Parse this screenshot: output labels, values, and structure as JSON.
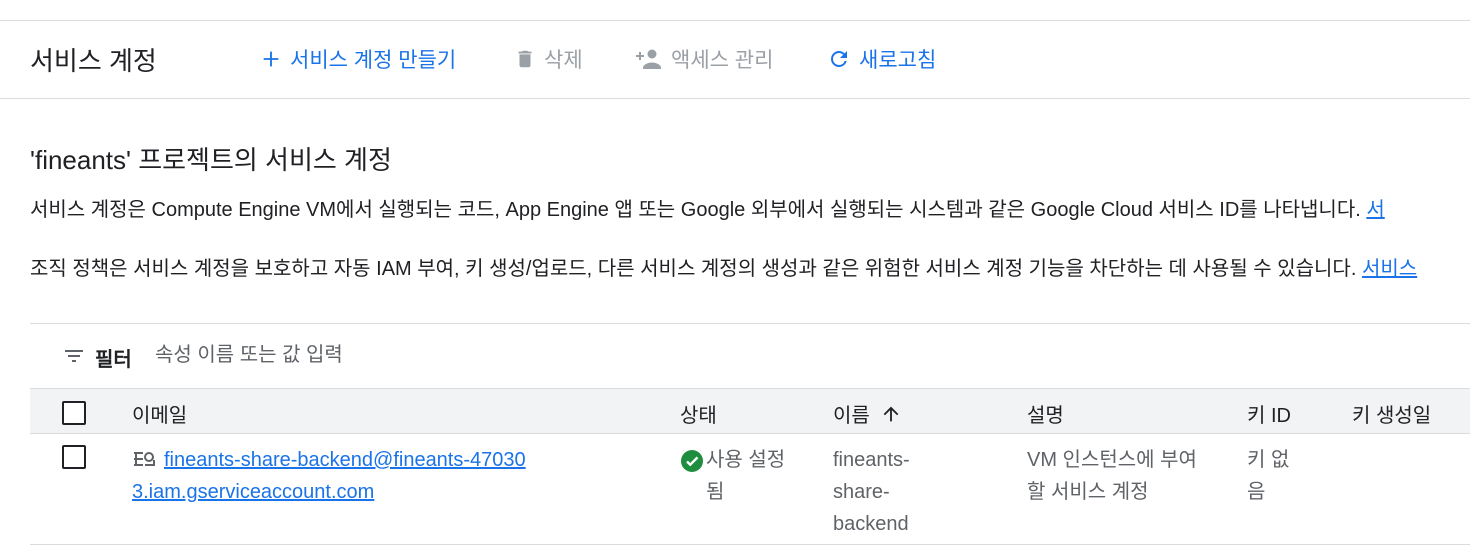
{
  "toolbar": {
    "title": "서비스 계정",
    "create_label": "서비스 계정 만들기",
    "delete_label": "삭제",
    "manage_access_label": "액세스 관리",
    "refresh_label": "새로고침"
  },
  "section": {
    "title": "'fineants' 프로젝트의 서비스 계정",
    "description_1": "서비스 계정은 Compute Engine VM에서 실행되는 코드, App Engine 앱 또는 Google 외부에서 실행되는 시스템과 같은 Google Cloud 서비스 ID를 나타냅니다. ",
    "description_1_link": "서",
    "description_2": "조직 정책은 서비스 계정을 보호하고 자동 IAM 부여, 키 생성/업로드, 다른 서비스 계정의 생성과 같은 위험한 서비스 계정 기능을 차단하는 데 사용될 수 있습니다. ",
    "description_2_link": "서비스"
  },
  "filter": {
    "label": "필터",
    "placeholder": "속성 이름 또는 값 입력"
  },
  "table": {
    "columns": {
      "email": "이메일",
      "status": "상태",
      "name": "이름",
      "description": "설명",
      "key_id": "키 ID",
      "key_created": "키 생성일"
    },
    "sort": {
      "column": "name",
      "direction": "ascending"
    },
    "rows": [
      {
        "email": "fineants-share-backend@fineants-470303.iam.gserviceaccount.com",
        "status": "사용 설정됨",
        "name": "fineants-share-backend",
        "description": "VM 인스턴스에 부여할 서비스 계정",
        "key_id": "키 없음",
        "key_created": ""
      }
    ]
  },
  "icons": {
    "create": "plus-icon",
    "delete": "trash-icon",
    "manage_access": "person-add-icon",
    "refresh": "refresh-icon",
    "filter": "filter-icon",
    "status": "check-circle-icon",
    "email": "key-icon",
    "sort": "arrow-up-icon"
  },
  "colors": {
    "accent": "#1a73e8",
    "disabled": "#9aa0a6",
    "success": "#1e8e3e",
    "header_bg": "#f1f3f4",
    "divider": "#dadce0"
  }
}
